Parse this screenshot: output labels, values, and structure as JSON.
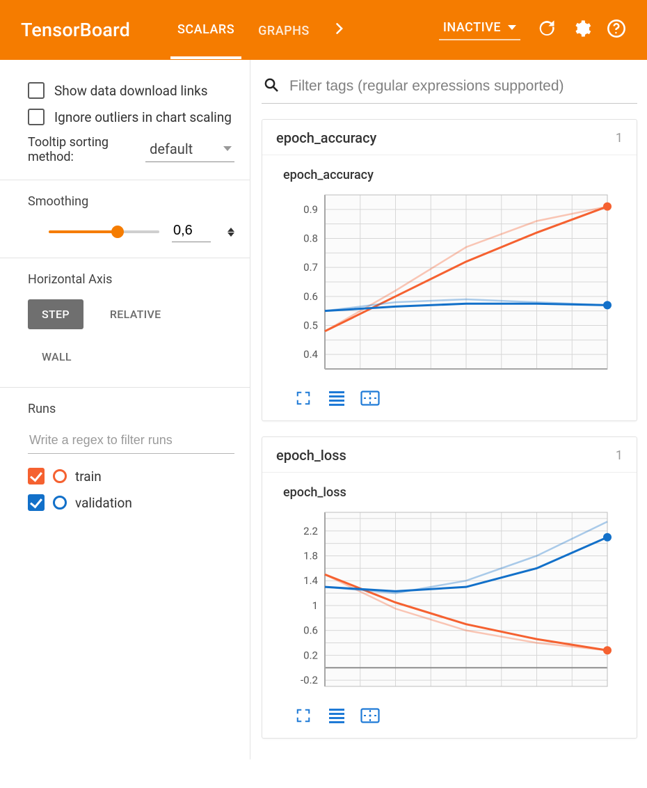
{
  "header": {
    "app_title": "TensorBoard",
    "tabs": [
      {
        "label": "SCALARS",
        "active": true
      },
      {
        "label": "GRAPHS",
        "active": false
      }
    ],
    "inactive_label": "INACTIVE"
  },
  "sidebar": {
    "show_download_label": "Show data download links",
    "show_download_checked": false,
    "ignore_outliers_label": "Ignore outliers in chart scaling",
    "ignore_outliers_checked": false,
    "tooltip_sort_label": "Tooltip sorting method:",
    "tooltip_sort_value": "default",
    "smoothing_title": "Smoothing",
    "smoothing_value": "0,6",
    "horizontal_axis_title": "Horizontal Axis",
    "axis_options": [
      {
        "label": "STEP",
        "active": true
      },
      {
        "label": "RELATIVE",
        "active": false
      },
      {
        "label": "WALL",
        "active": false
      }
    ],
    "runs_title": "Runs",
    "runs_filter_placeholder": "Write a regex to filter runs",
    "runs": [
      {
        "label": "train",
        "color": "#f56130",
        "checked": true
      },
      {
        "label": "validation",
        "color": "#1270c9",
        "checked": true
      }
    ]
  },
  "filter_placeholder": "Filter tags (regular expressions supported)",
  "cards": [
    {
      "head": "epoch_accuracy",
      "count": "1",
      "chart_title": "epoch_accuracy"
    },
    {
      "head": "epoch_loss",
      "count": "1",
      "chart_title": "epoch_loss"
    }
  ],
  "chart_data": [
    {
      "type": "line",
      "title": "epoch_accuracy",
      "xlabel": "",
      "ylabel": "",
      "xlim": [
        0,
        4
      ],
      "ylim": [
        0.35,
        0.95
      ],
      "yticks": [
        0.4,
        0.5,
        0.6,
        0.7,
        0.8,
        0.9
      ],
      "series": [
        {
          "name": "train",
          "color": "#f56130",
          "x": [
            0,
            1,
            2,
            3,
            4
          ],
          "smoothed": [
            0.48,
            0.6,
            0.72,
            0.82,
            0.91
          ],
          "raw": [
            0.48,
            0.62,
            0.77,
            0.86,
            0.91
          ]
        },
        {
          "name": "validation",
          "color": "#1270c9",
          "x": [
            0,
            1,
            2,
            3,
            4
          ],
          "smoothed": [
            0.55,
            0.565,
            0.575,
            0.575,
            0.57
          ],
          "raw": [
            0.55,
            0.58,
            0.59,
            0.58,
            0.57
          ]
        }
      ]
    },
    {
      "type": "line",
      "title": "epoch_loss",
      "xlabel": "",
      "ylabel": "",
      "xlim": [
        0,
        4
      ],
      "ylim": [
        -0.3,
        2.5
      ],
      "yticks": [
        -0.2,
        0.2,
        0.6,
        1.0,
        1.4,
        1.8,
        2.2
      ],
      "series": [
        {
          "name": "train",
          "color": "#f56130",
          "x": [
            0,
            1,
            2,
            3,
            4
          ],
          "smoothed": [
            1.5,
            1.05,
            0.7,
            0.46,
            0.28
          ],
          "raw": [
            1.5,
            0.95,
            0.6,
            0.4,
            0.28
          ]
        },
        {
          "name": "validation",
          "color": "#1270c9",
          "x": [
            0,
            1,
            2,
            3,
            4
          ],
          "smoothed": [
            1.3,
            1.23,
            1.3,
            1.6,
            2.1
          ],
          "raw": [
            1.3,
            1.2,
            1.4,
            1.8,
            2.35
          ]
        }
      ]
    }
  ]
}
